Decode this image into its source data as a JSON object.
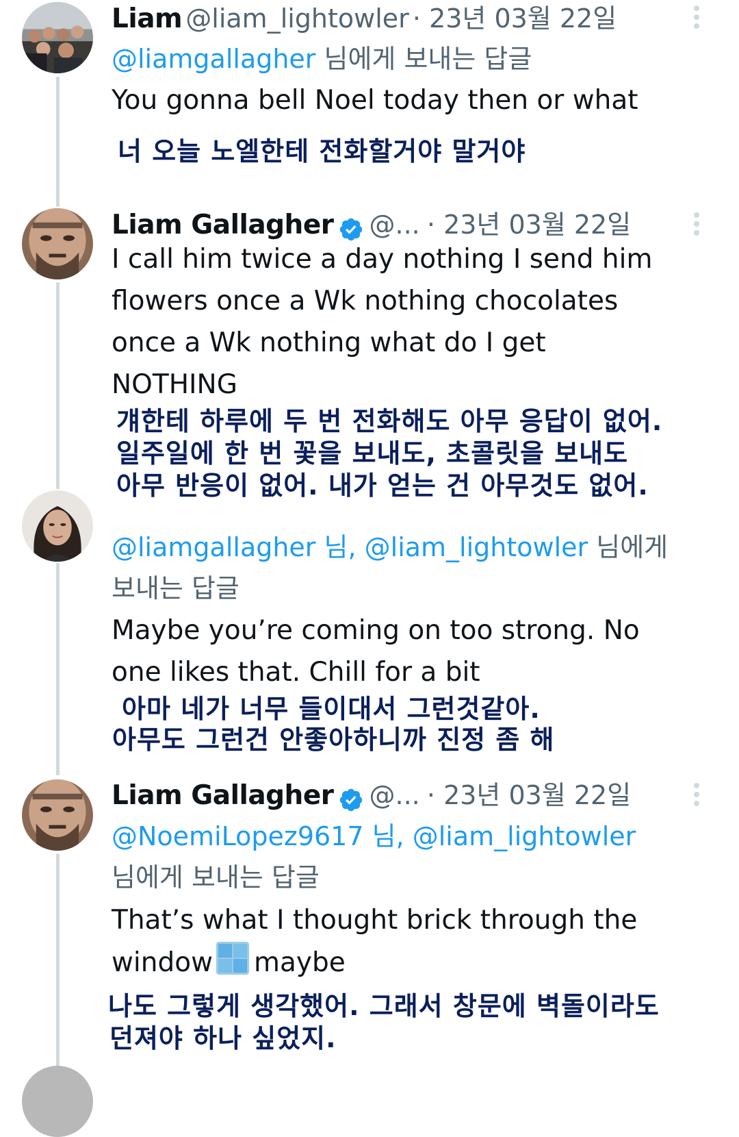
{
  "tweets": [
    {
      "name": "Liam",
      "handle": "@liam_lightowler",
      "date": "· 23년 03월 22일",
      "reply_mentions": "@liamgallagher",
      "reply_suffix": " 님에게 보내는 답글",
      "text": "You gonna bell Noel today then or what",
      "translation": [
        "너 오늘 노엘한테 전화할거야 말거야"
      ]
    },
    {
      "name": "Liam Gallagher",
      "handle": "@...",
      "date": "· 23년 03월 22일",
      "verified": true,
      "text_lines": [
        "I call him twice a day nothing I send him",
        "flowers once a Wk nothing chocolates",
        "once a Wk nothing what do I get",
        "NOTHING"
      ],
      "translation": [
        "걔한테 하루에 두 번 전화해도 아무 응답이 없어.",
        "일주일에 한 번 꽃을 보내도, 초콜릿을 보내도",
        "아무 반응이 없어. 내가 얻는 건 아무것도 없어."
      ]
    },
    {
      "reply_mentions": "@liamgallagher 님, @liam_lightowler",
      "reply_suffix_1": " 님에게",
      "reply_suffix_2": "보내는 답글",
      "text_lines": [
        "Maybe you’re coming on too strong. No",
        "one likes that. Chill for a bit"
      ],
      "translation": [
        "아마 네가 너무 들이대서 그런것같아.",
        "아무도 그런건 안좋아하니까 진정 좀 해"
      ]
    },
    {
      "name": "Liam Gallagher",
      "handle": "@...",
      "date": "· 23년 03월 22일",
      "verified": true,
      "reply_mentions": "@NoemiLopez9617 님, @liam_lightowler",
      "reply_suffix": "님에게 보내는 답글",
      "text_line_1": "That’s what I thought brick through the",
      "text_line_2_before": "window",
      "text_line_2_icon": "window-emoji-icon",
      "text_line_2_after": "maybe",
      "translation": [
        "나도 그렇게 생각했어. 그래서 창문에 벽돌이라도",
        "던져야 하나 싶었지."
      ]
    }
  ],
  "colors": {
    "link": "#1d9bf0",
    "secondary_text": "#536471",
    "translation": "#0a1f5c",
    "thread_line": "#cfd9de"
  }
}
